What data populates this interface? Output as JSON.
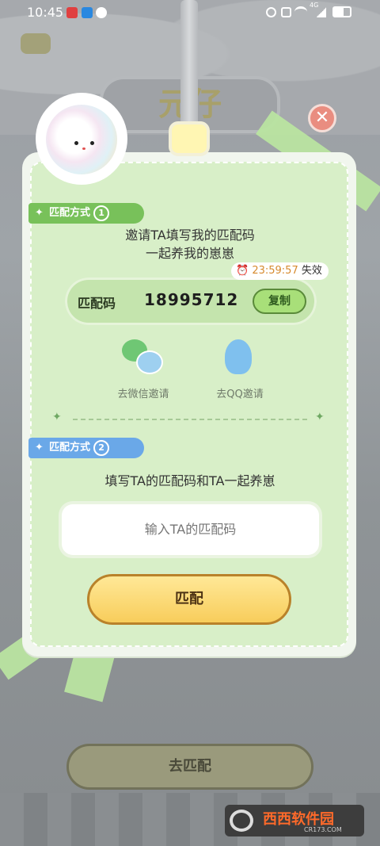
{
  "status_bar": {
    "time": "10:45",
    "network": "4G"
  },
  "background": {
    "title_text": "元仔"
  },
  "dialog": {
    "method1": {
      "label": "匹配方式",
      "number": "1",
      "line1": "邀请TA填写我的匹配码",
      "line2": "一起养我的崽崽"
    },
    "timer": {
      "time": "23:59:57",
      "suffix": "失效"
    },
    "code": {
      "label": "匹配码",
      "value": "18995712",
      "copy_label": "复制"
    },
    "share": [
      {
        "label": "去微信邀请",
        "icon": "wechat-icon"
      },
      {
        "label": "去QQ邀请",
        "icon": "qq-icon"
      }
    ],
    "method2": {
      "label": "匹配方式",
      "number": "2",
      "desc": "填写TA的匹配码和TA一起养崽"
    },
    "input": {
      "placeholder": "输入TA的匹配码",
      "value": ""
    },
    "match_button": "匹配"
  },
  "bottom_button": "去匹配",
  "watermark": {
    "text": "西西软件园",
    "sub": "CR173.COM"
  },
  "colors": {
    "card_green": "#d8efc8",
    "ribbon_green": "#78c15a",
    "ribbon_blue": "#6aa8e8",
    "button_yellow": "#f8cd5b"
  }
}
